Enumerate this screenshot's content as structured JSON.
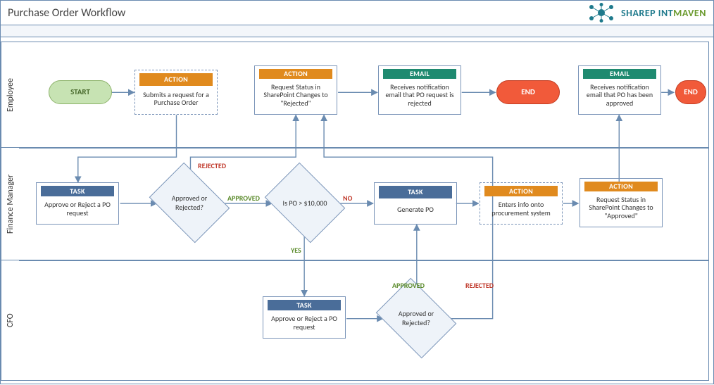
{
  "title": "Purchase Order Workflow",
  "logo": {
    "brand_a": "SHAREP   INT",
    "brand_b": "MAVEN"
  },
  "lanes": {
    "employee": "Employee",
    "finance": "Finance Manager",
    "cfo": "CFO"
  },
  "labels": {
    "start": "START",
    "end": "END",
    "action": "ACTION",
    "email": "EMAIL",
    "task": "TASK",
    "approved": "APPROVED",
    "rejected": "REJECTED",
    "yes": "YES",
    "no": "NO"
  },
  "nodes": {
    "emp_submit": "Submits a request for a Purchase Order",
    "emp_status_rejected": "Request Status in SharePoint Changes to \"Rejected\"",
    "emp_email_rejected": "Receives notification email that PO request is rejected",
    "emp_email_approved": "Receives notification email that PO has been approved",
    "fm_task_approve": "Approve or Reject a PO request",
    "fm_decision1": "Approved or Rejected?",
    "fm_decision2": "Is PO > $10,000",
    "fm_task_generate": "Generate PO",
    "fm_action_enter": "Enters info onto procurement system",
    "fm_action_status_approved": "Request Status in SharePoint Changes to \"Approved\"",
    "cfo_task_approve": "Approve or Reject a PO request",
    "cfo_decision": "Approved or Rejected?"
  }
}
